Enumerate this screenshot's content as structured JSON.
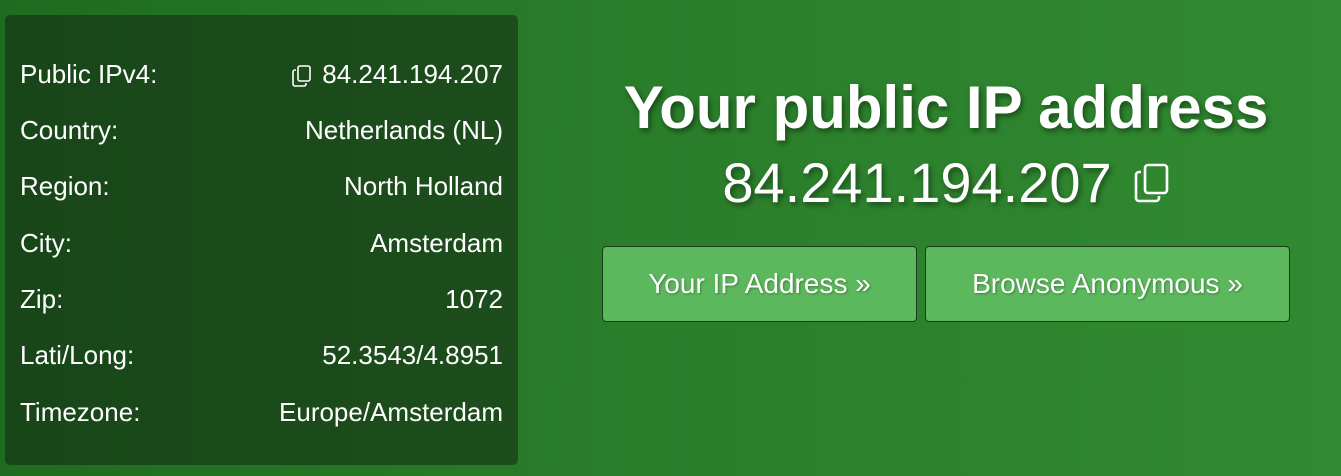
{
  "info": {
    "rows": [
      {
        "label": "Public IPv4:",
        "value": "84.241.194.207",
        "icon": "copy-icon"
      },
      {
        "label": "Country:",
        "value": "Netherlands (NL)"
      },
      {
        "label": "Region:",
        "value": "North Holland"
      },
      {
        "label": "City:",
        "value": "Amsterdam"
      },
      {
        "label": "Zip:",
        "value": "1072"
      },
      {
        "label": "Lati/Long:",
        "value": "52.3543/4.8951"
      },
      {
        "label": "Timezone:",
        "value": "Europe/Amsterdam"
      }
    ]
  },
  "hero": {
    "title": "Your public IP address",
    "ip": "84.241.194.207",
    "icon": "copy-icon"
  },
  "buttons": {
    "ip_address": "Your IP Address »",
    "browse_anonymous": "Browse Anonymous »"
  },
  "colors": {
    "background": "#2a7d2a",
    "panel": "#234d1f",
    "button": "#5cb85c"
  }
}
